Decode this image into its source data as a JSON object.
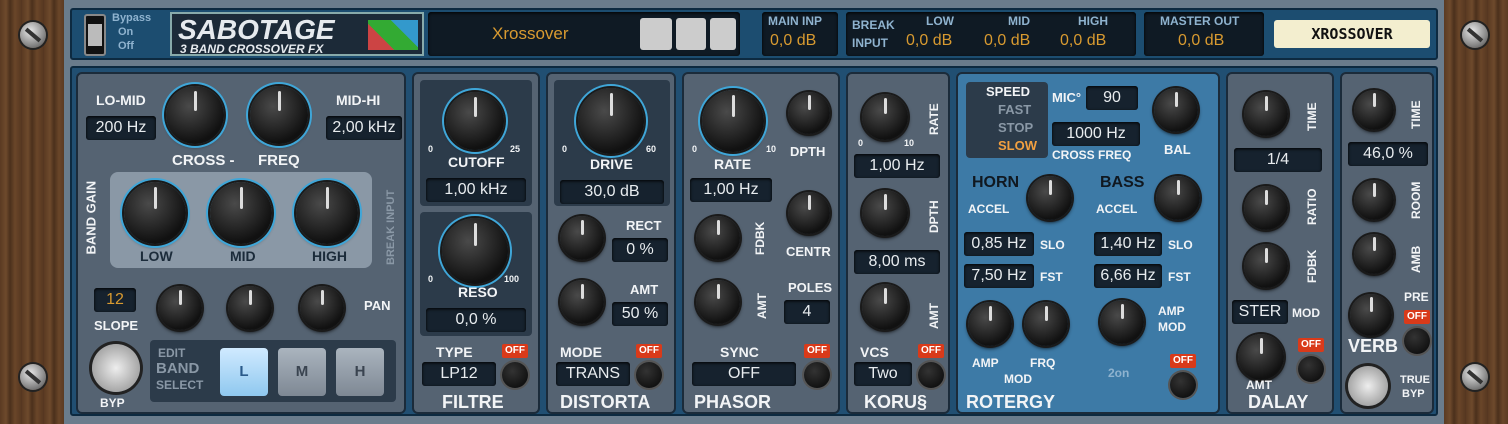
{
  "top": {
    "bypass": "Bypass",
    "on": "On",
    "off": "Off",
    "brand": "SABOTAGE",
    "subtitle": "3 BAND CROSSOVER FX",
    "preset": "Xrossover",
    "main_inp_label": "MAIN INP",
    "main_inp": "0,0 dB",
    "break_label": "BREAK",
    "input_label": "INPUT",
    "low_label": "LOW",
    "low": "0,0 dB",
    "mid_label": "MID",
    "mid": "0,0 dB",
    "high_label": "HIGH",
    "high": "0,0 dB",
    "master_label": "MASTER OUT",
    "master": "0,0 dB",
    "tape": "XROSSOVER"
  },
  "cross": {
    "lomid": "LO-MID",
    "lomid_val": "200 Hz",
    "midhi": "MID-HI",
    "midhi_val": "2,00 kHz",
    "cross": "CROSS -",
    "freq": "FREQ",
    "band_gain": "BAND GAIN",
    "low": "LOW",
    "mid": "MID",
    "high": "HIGH",
    "break_input": "BREAK INPUT",
    "slope_val": "12",
    "slope": "SLOPE",
    "pan": "PAN",
    "edit": "EDIT",
    "band": "BAND",
    "select": "SELECT",
    "l": "L",
    "m": "M",
    "h": "H",
    "byp": "BYP"
  },
  "filtre": {
    "cutoff": "CUTOFF",
    "cutoff_val": "1,00 kHz",
    "reso": "RESO",
    "reso_val": "0,0 %",
    "type": "TYPE",
    "type_val": "LP12",
    "off": "OFF",
    "title": "FILTRE",
    "s0": "0",
    "s25": "25",
    "s100": "100"
  },
  "distorta": {
    "drive": "DRIVE",
    "drive_val": "30,0 dB",
    "rect": "RECT",
    "rect_val": "0 %",
    "amt": "AMT",
    "amt_val": "50 %",
    "mode": "MODE",
    "mode_val": "TRANS",
    "off": "OFF",
    "title": "DISTORTA",
    "s0": "0",
    "s60": "60"
  },
  "phasor": {
    "rate": "RATE",
    "rate_val": "1,00 Hz",
    "dpth": "DPTH",
    "fdbk": "FDBK",
    "centr": "CENTR",
    "amt": "AMT",
    "poles": "POLES",
    "poles_val": "4",
    "sync": "SYNC",
    "sync_val": "OFF",
    "off": "OFF",
    "title": "PHASOR",
    "s0": "0",
    "s10": "10"
  },
  "korus": {
    "rate": "RATE",
    "rate_val": "1,00 Hz",
    "dpth": "DPTH",
    "dpth_val": "8,00 ms",
    "amt": "AMT",
    "vcs": "VCS",
    "vcs_val": "Two",
    "off": "OFF",
    "title": "KORU§",
    "s0": "0",
    "s10": "10"
  },
  "rotergy": {
    "speed": "SPEED",
    "fast": "FAST",
    "stop": "STOP",
    "slow": "SLOW",
    "mic": "MIC°",
    "mic_val": "90",
    "bal": "BAL",
    "cross_val": "1000 Hz",
    "cross_freq": "CROSS FREQ",
    "horn": "HORN",
    "accel": "ACCEL",
    "slo_val": "0,85 Hz",
    "slo": "SLO",
    "fst_val": "7,50 Hz",
    "fst": "FST",
    "bass": "BASS",
    "accel2": "ACCEL",
    "bslo_val": "1,40 Hz",
    "bslo": "SLO",
    "bfst_val": "6,66 Hz",
    "bfst": "FST",
    "amp_mod": "AMP",
    "amp_mod2": "MOD",
    "amp": "AMP",
    "frq": "FRQ",
    "mod": "MOD",
    "zon": "2on",
    "off": "OFF",
    "title": "ROTERGY"
  },
  "dalay": {
    "time": "TIME",
    "time_val": "1/4",
    "ratio": "RATIO",
    "fdbk": "FDBK",
    "ster": "STER",
    "mod": "MOD",
    "amt": "AMT",
    "off": "OFF",
    "title": "DALAY"
  },
  "verb": {
    "time": "TIME",
    "time_val": "46,0 %",
    "room": "ROOM",
    "amb": "AMB",
    "pre": "PRE",
    "off": "OFF",
    "title": "VERB",
    "true": "TRUE",
    "byp": "BYP"
  }
}
